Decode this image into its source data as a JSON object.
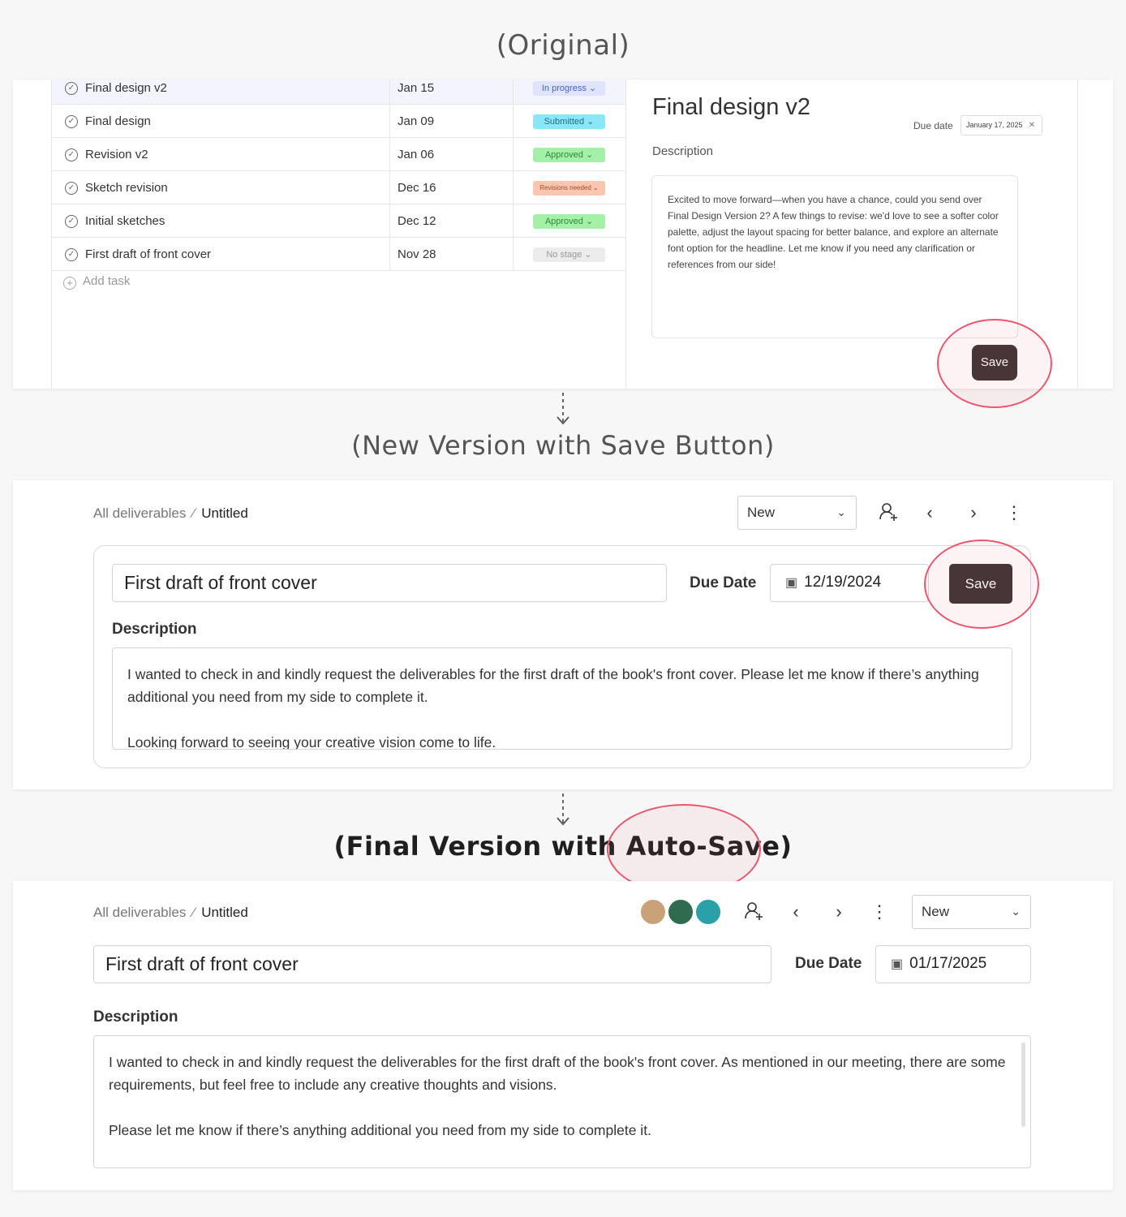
{
  "headings": {
    "original": "(Original)",
    "new_version": "(New Version with Save Button)",
    "final_prefix": "(Final Version with ",
    "final_highlight": "Auto-Save",
    "final_suffix": ")"
  },
  "original": {
    "tasks": [
      {
        "name": "Final design v2",
        "date": "Jan 15",
        "stage": "In progress",
        "stage_bg": "#dfe4fb",
        "stage_fg": "#4a5fc9"
      },
      {
        "name": "Final design",
        "date": "Jan 09",
        "stage": "Submitted",
        "stage_bg": "#8de6f7",
        "stage_fg": "#1d6f86"
      },
      {
        "name": "Revision v2",
        "date": "Jan 06",
        "stage": "Approved",
        "stage_bg": "#a5f0a9",
        "stage_fg": "#2c8a33"
      },
      {
        "name": "Sketch revision",
        "date": "Dec 16",
        "stage": "Revisions needed",
        "stage_bg": "#fbc6b0",
        "stage_fg": "#a14d2b"
      },
      {
        "name": "Initial sketches",
        "date": "Dec 12",
        "stage": "Approved",
        "stage_bg": "#a5f0a9",
        "stage_fg": "#2c8a33"
      },
      {
        "name": "First draft of front cover",
        "date": "Nov 28",
        "stage": "No stage",
        "stage_bg": "#ececec",
        "stage_fg": "#9a9a9a"
      }
    ],
    "add_task": "Add task",
    "detail": {
      "title": "Final design v2",
      "due_label": "Due date",
      "due_value": "January 17, 2025",
      "description_label": "Description",
      "description": "Excited to move forward—when you have a chance, could you send over Final Design Version 2? A few things to revise: we'd love to see a softer color palette, adjust the layout spacing for better balance, and explore an alternate font option for the headline. Let me know if you need any clarification or references from our side!",
      "save_label": "Save"
    }
  },
  "new_version": {
    "breadcrumb_root": "All deliverables",
    "breadcrumb_current": "Untitled",
    "status": "New",
    "title_value": "First draft of front cover",
    "due_label": "Due Date",
    "due_value": "12/19/2024",
    "save_label": "Save",
    "description_label": "Description",
    "description_p1": "I wanted to check in and kindly request the deliverables for the first draft of the book's front cover. Please let me know if there’s anything additional you need from my side to complete it.",
    "description_p2": "Looking forward to seeing your creative vision come to life."
  },
  "final_version": {
    "breadcrumb_root": "All deliverables",
    "breadcrumb_current": "Untitled",
    "status": "New",
    "title_value": "First draft of front cover",
    "due_label": "Due Date",
    "due_value": "01/17/2025",
    "description_label": "Description",
    "description_p1": "I wanted to check in and kindly request the deliverables for the first draft of the book's front cover. As mentioned in our meeting, there are some requirements, but feel free to include any creative thoughts and visions.",
    "description_p2": "Please let me know if there’s anything additional you need from my side to complete it.",
    "avatar_colors": [
      "#c9a27a",
      "#2f6b4f",
      "#2aa0a8"
    ]
  },
  "colors": {
    "accent_circle": "#e8576e",
    "save_button": "#3a3232"
  }
}
